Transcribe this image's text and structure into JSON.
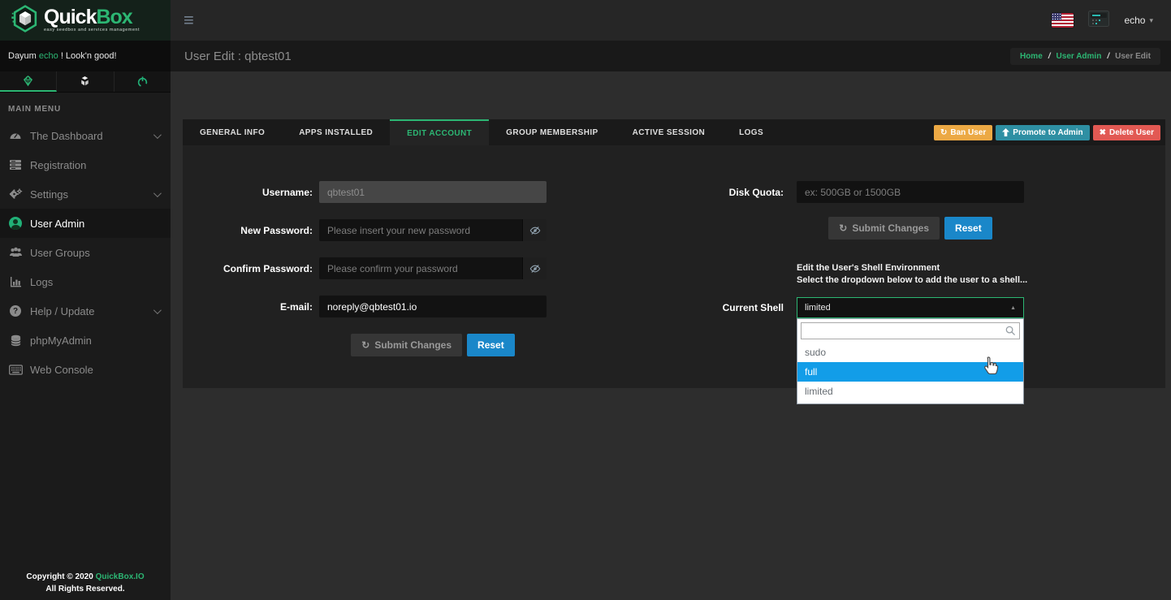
{
  "brand": {
    "quick": "Quick",
    "box": "Box",
    "tagline": "easy seedbox and services management"
  },
  "topbar": {
    "user_label": "echo"
  },
  "icons": {
    "hamburger": "≡",
    "caret_down": "▾",
    "refresh": "↻",
    "x_mark": "✖",
    "caret_up": "▲"
  },
  "sidebar": {
    "greeting": {
      "prefix": "Dayum ",
      "user": "echo",
      "suffix": " ! Look'n good!"
    },
    "section_label": "MAIN MENU",
    "items": [
      {
        "label": "The Dashboard",
        "expandable": true
      },
      {
        "label": "Registration",
        "expandable": false
      },
      {
        "label": "Settings",
        "expandable": true
      },
      {
        "label": "User Admin",
        "active": true
      },
      {
        "label": "User Groups",
        "expandable": false
      },
      {
        "label": "Logs",
        "expandable": false
      },
      {
        "label": "Help / Update",
        "expandable": true
      },
      {
        "label": "phpMyAdmin",
        "expandable": false
      },
      {
        "label": "Web Console",
        "expandable": false
      }
    ],
    "footer": {
      "line1_prefix": "Copyright © 2020 ",
      "line1_link": "QuickBox.IO",
      "line2": "All Rights Reserved."
    }
  },
  "header": {
    "title": "User Edit : qbtest01",
    "breadcrumb": {
      "home": "Home",
      "section": "User Admin",
      "current": "User Edit",
      "separator": "/"
    }
  },
  "tabs": [
    {
      "label": "GENERAL INFO"
    },
    {
      "label": "APPS INSTALLED"
    },
    {
      "label": "EDIT ACCOUNT",
      "active": true
    },
    {
      "label": "GROUP MEMBERSHIP"
    },
    {
      "label": "ACTIVE SESSION"
    },
    {
      "label": "LOGS"
    }
  ],
  "user_actions": {
    "ban": "Ban User",
    "promote": "Promote to Admin",
    "delete": "Delete User"
  },
  "account_form": {
    "username": {
      "label": "Username:",
      "value": "qbtest01"
    },
    "new_password": {
      "label": "New Password:",
      "placeholder": "Please insert your new password"
    },
    "confirm_password": {
      "label": "Confirm Password:",
      "placeholder": "Please confirm your password"
    },
    "email": {
      "label": "E-mail:",
      "value": "noreply@qbtest01.io"
    },
    "submit_label": "Submit Changes",
    "reset_label": "Reset"
  },
  "quota_form": {
    "disk_quota": {
      "label": "Disk Quota:",
      "placeholder": "ex: 500GB or 1500GB"
    },
    "submit_label": "Submit Changes",
    "reset_label": "Reset"
  },
  "shell": {
    "help_line1": "Edit the User's Shell Environment",
    "help_line2": "Select the dropdown below to add the user to a shell...",
    "label": "Current Shell",
    "selected": "limited",
    "search_value": "",
    "options": [
      {
        "label": "sudo",
        "highlighted": false
      },
      {
        "label": "full",
        "highlighted": true
      },
      {
        "label": "limited",
        "highlighted": false
      }
    ]
  },
  "colors": {
    "accent_green": "#2cb673",
    "highlight_blue": "#129de8",
    "ban_orange": "#eca944",
    "promote_teal": "#2e8fa3",
    "delete_red": "#e25953",
    "reset_blue": "#1a87c9"
  }
}
